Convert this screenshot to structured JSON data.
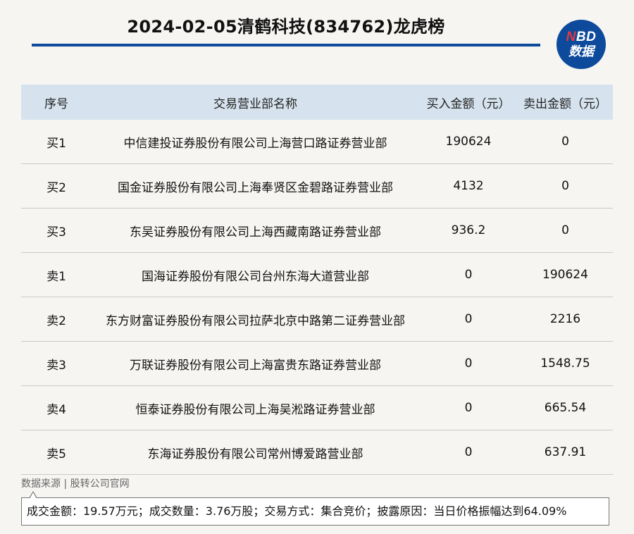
{
  "header": {
    "title": "2024-02-05清鹤科技(834762)龙虎榜",
    "logo_line1_letter": "N",
    "logo_line1_rest": "BD",
    "logo_line2": "数据"
  },
  "table": {
    "columns": [
      "序号",
      "交易营业部名称",
      "买入金额（元）",
      "卖出金额（元）"
    ],
    "rows": [
      {
        "rank": "买1",
        "name": "中信建投证券股份有限公司上海营口路证券营业部",
        "buy": "190624",
        "sell": "0"
      },
      {
        "rank": "买2",
        "name": "国金证券股份有限公司上海奉贤区金碧路证券营业部",
        "buy": "4132",
        "sell": "0"
      },
      {
        "rank": "买3",
        "name": "东吴证券股份有限公司上海西藏南路证券营业部",
        "buy": "936.2",
        "sell": "0"
      },
      {
        "rank": "卖1",
        "name": "国海证券股份有限公司台州东海大道营业部",
        "buy": "0",
        "sell": "190624"
      },
      {
        "rank": "卖2",
        "name": "东方财富证券股份有限公司拉萨北京中路第二证券营业部",
        "buy": "0",
        "sell": "2216"
      },
      {
        "rank": "卖3",
        "name": "万联证券股份有限公司上海富贵东路证券营业部",
        "buy": "0",
        "sell": "1548.75"
      },
      {
        "rank": "卖4",
        "name": "恒泰证券股份有限公司上海吴淞路证券营业部",
        "buy": "0",
        "sell": "665.54"
      },
      {
        "rank": "卖5",
        "name": "东海证券股份有限公司常州博爱路营业部",
        "buy": "0",
        "sell": "637.91"
      }
    ]
  },
  "footer": {
    "source": "数据来源 | 股转公司官网",
    "note": "成交金额：19.57万元；成交数量：3.76万股；交易方式：集合竞价；披露原因：当日价格振幅达到64.09%"
  },
  "colors": {
    "accent": "#0d4a9c",
    "header_bg": "#d6e3ee",
    "logo_red": "#e8383d",
    "page_bg": "#f7f5f2"
  }
}
